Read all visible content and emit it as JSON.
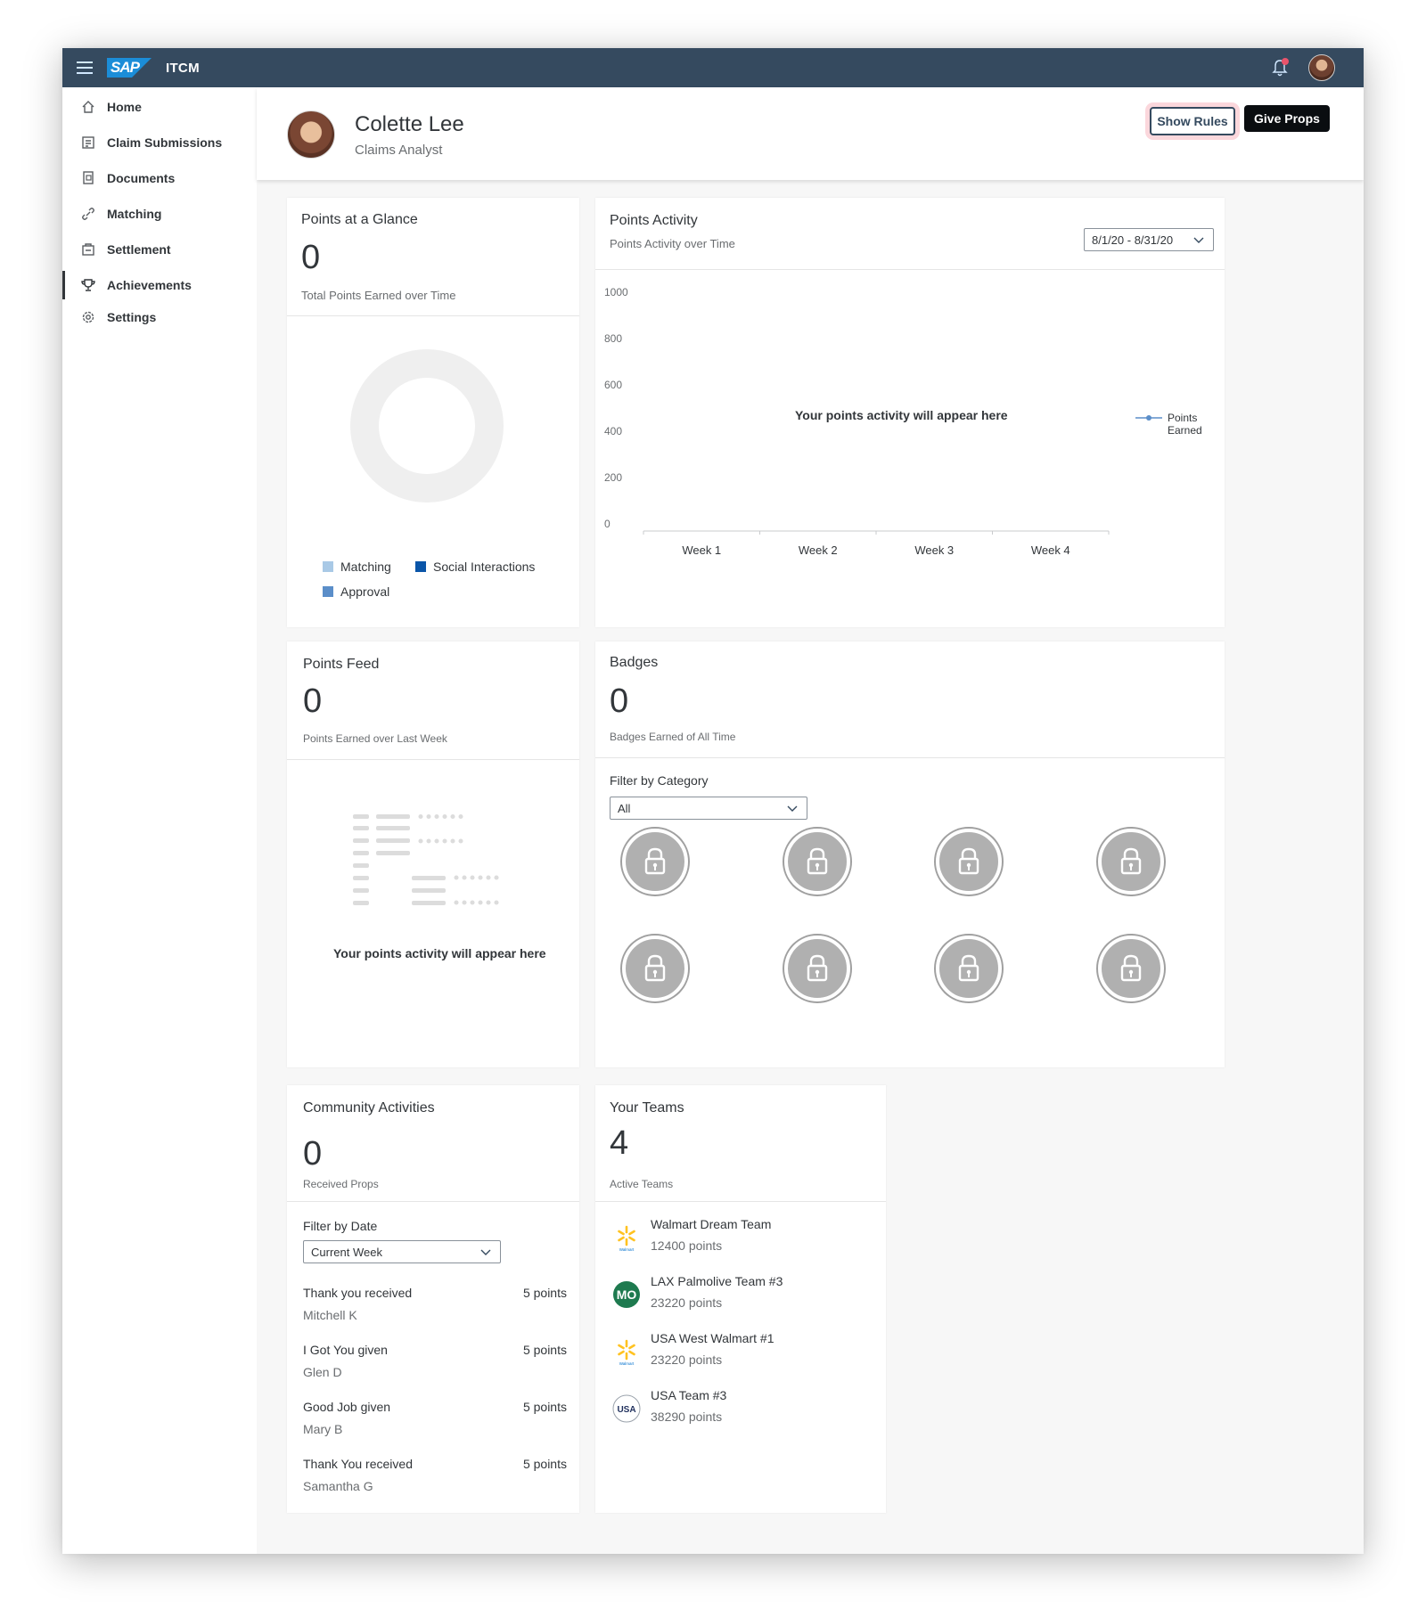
{
  "shell": {
    "logo_text": "SAP",
    "product": "ITCM",
    "colors": {
      "shell_bg": "#354a5f",
      "accent": "#0a6ed1",
      "notification": "#e9546b"
    }
  },
  "sidebar": {
    "items": [
      {
        "label": "Home",
        "icon": "home-icon"
      },
      {
        "label": "Claim Submissions",
        "icon": "claim-icon"
      },
      {
        "label": "Documents",
        "icon": "documents-icon"
      },
      {
        "label": "Matching",
        "icon": "link-icon"
      },
      {
        "label": "Settlement",
        "icon": "settlement-icon"
      },
      {
        "label": "Achievements",
        "icon": "trophy-icon",
        "active": true
      },
      {
        "label": "Settings",
        "icon": "gear-icon"
      }
    ]
  },
  "profile": {
    "name": "Colette Lee",
    "role": "Claims Analyst",
    "show_rules_label": "Show Rules",
    "give_props_label": "Give Props"
  },
  "glance": {
    "title": "Points at a Glance",
    "value": "0",
    "subtitle": "Total Points Earned over Time",
    "legend": [
      {
        "label": "Matching",
        "color": "#a9c9e6"
      },
      {
        "label": "Social Interactions",
        "color": "#0a55a8"
      },
      {
        "label": "Approval",
        "color": "#5b8ec9"
      }
    ]
  },
  "activity": {
    "title": "Points Activity",
    "subtitle": "Points Activity over Time",
    "date_range": "8/1/20 - 8/31/20",
    "empty_message": "Your points activity will appear here"
  },
  "chart_data": {
    "type": "line",
    "categories": [
      "Week 1",
      "Week 2",
      "Week 3",
      "Week 4"
    ],
    "series": [
      {
        "name": "Points Earned",
        "values": []
      }
    ],
    "y_ticks": [
      "1000",
      "800",
      "600",
      "400",
      "200",
      "0"
    ],
    "ylim": [
      0,
      1000
    ],
    "legend_line1": "Points",
    "legend_line2": "Earned",
    "legend_position": "right",
    "grid": false,
    "colors": {
      "series": "#5b8ec9"
    }
  },
  "feed": {
    "title": "Points Feed",
    "value": "0",
    "subtitle": "Points Earned over Last Week",
    "empty_message": "Your points activity will appear here"
  },
  "badges": {
    "title": "Badges",
    "value": "0",
    "subtitle": "Badges Earned of All Time",
    "filter_label": "Filter by Category",
    "filter_value": "All",
    "locked_count": 8
  },
  "community": {
    "title": "Community Activities",
    "value": "0",
    "subtitle": "Received Props",
    "filter_label": "Filter by Date",
    "filter_value": "Current Week",
    "items": [
      {
        "title": "Thank you received",
        "user": "Mitchell K",
        "points": "5 points"
      },
      {
        "title": "I Got You given",
        "user": "Glen D",
        "points": "5 points"
      },
      {
        "title": "Good Job given",
        "user": "Mary B",
        "points": "5 points"
      },
      {
        "title": "Thank You received",
        "user": "Samantha G",
        "points": "5 points"
      }
    ]
  },
  "teams": {
    "title": "Your Teams",
    "value": "4",
    "subtitle": "Active Teams",
    "items": [
      {
        "name": "Walmart Dream Team",
        "points": "12400 points",
        "logo": "walmart-spark-icon",
        "logo_text": "Walmart"
      },
      {
        "name": "LAX Palmolive Team #3",
        "points": "23220 points",
        "logo": "mo-logo",
        "logo_text": "MO"
      },
      {
        "name": "USA West Walmart #1",
        "points": "23220 points",
        "logo": "walmart-spark-icon",
        "logo_text": "Walmart"
      },
      {
        "name": "USA Team #3",
        "points": "38290 points",
        "logo": "team-usa-logo",
        "logo_text": "USA"
      }
    ]
  }
}
